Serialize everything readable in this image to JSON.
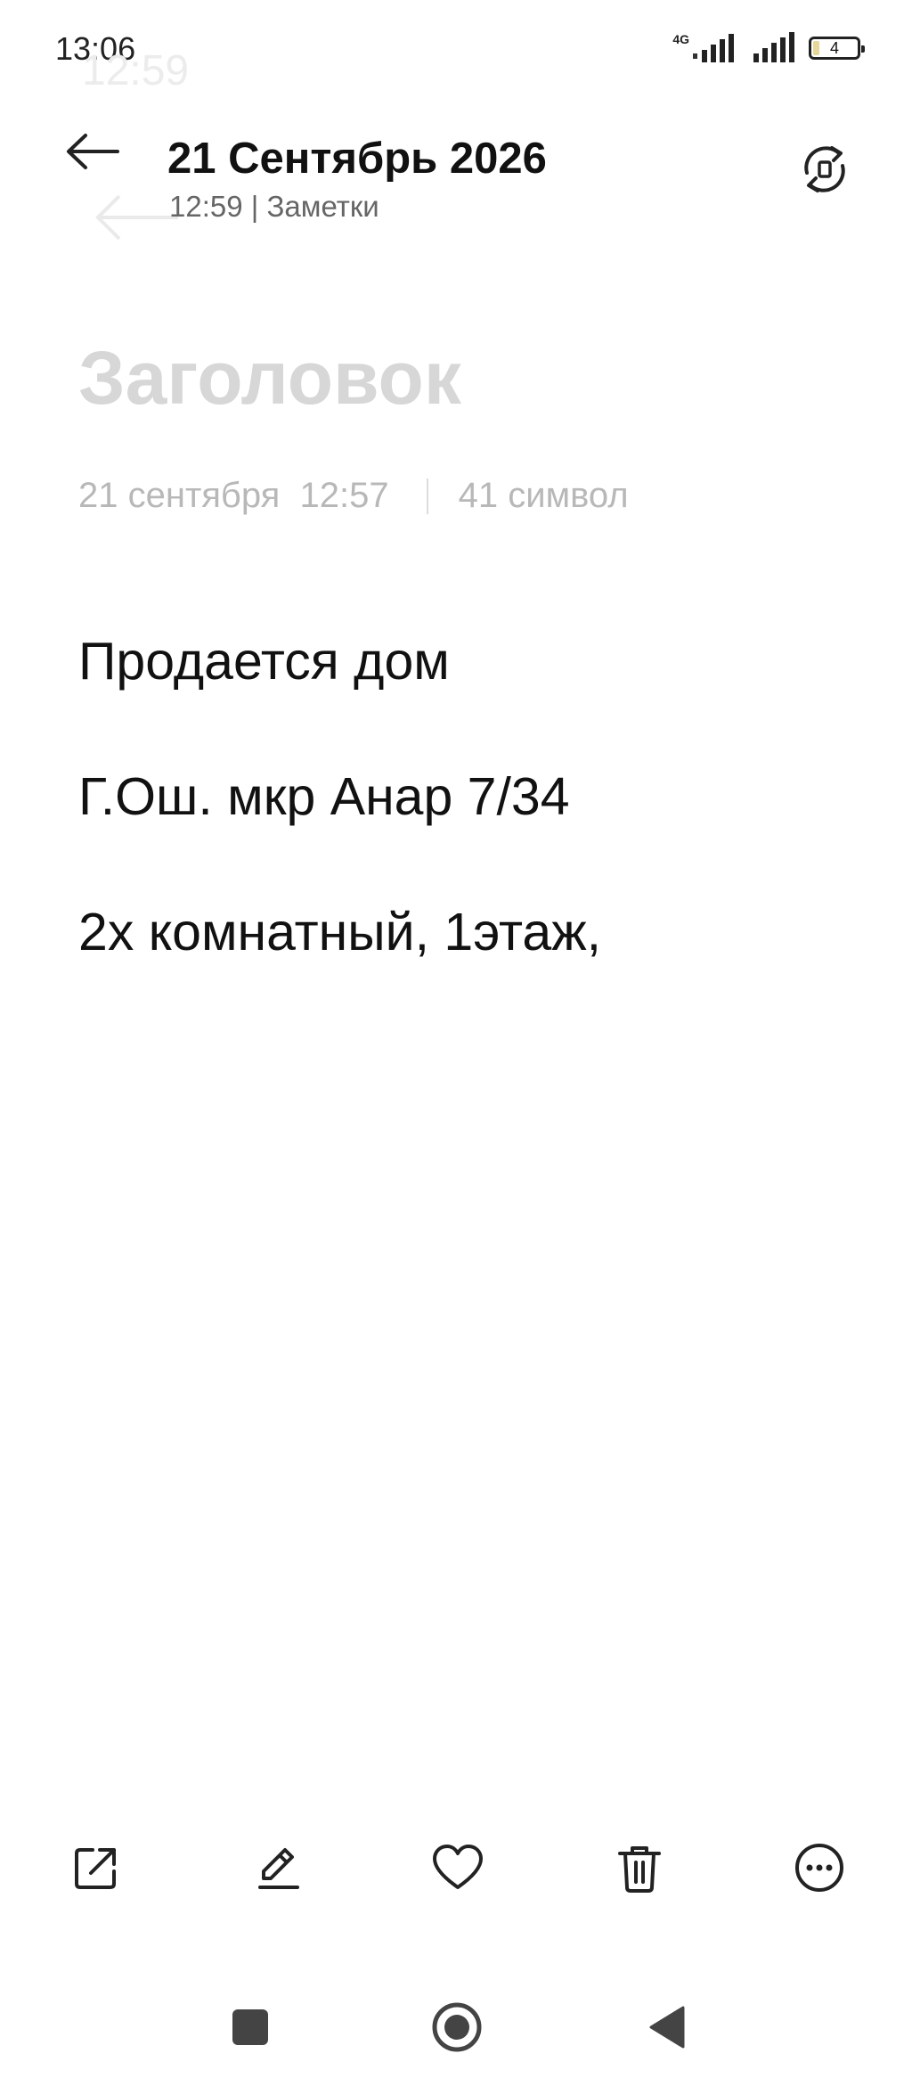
{
  "status_bar": {
    "time": "13:06",
    "network": "4G",
    "battery_level": "4",
    "battery_fill_fraction": 0.15,
    "icons": [
      "signal-4g-icon",
      "signal-icon",
      "battery-icon"
    ]
  },
  "ghost": {
    "time": "12:59"
  },
  "header": {
    "title": "21 Сентябрь 2026",
    "subtitle": "12:59 | Заметки",
    "back_icon": "arrow-left-icon",
    "rotate_icon": "rotate-icon"
  },
  "note": {
    "title_placeholder": "Заголовок",
    "meta": {
      "date": "21 сентября  12:57",
      "chars": "41 символ"
    },
    "lines": [
      "Продается дом",
      "Г.Ош. мкр Анар 7/34",
      "2х комнатный, 1этаж,"
    ]
  },
  "toolbar": {
    "items": [
      "share-icon",
      "edit-icon",
      "favorite-icon",
      "delete-icon",
      "more-icon"
    ]
  },
  "nav_bar": {
    "items": [
      "recents-icon",
      "home-icon",
      "back-icon"
    ]
  }
}
